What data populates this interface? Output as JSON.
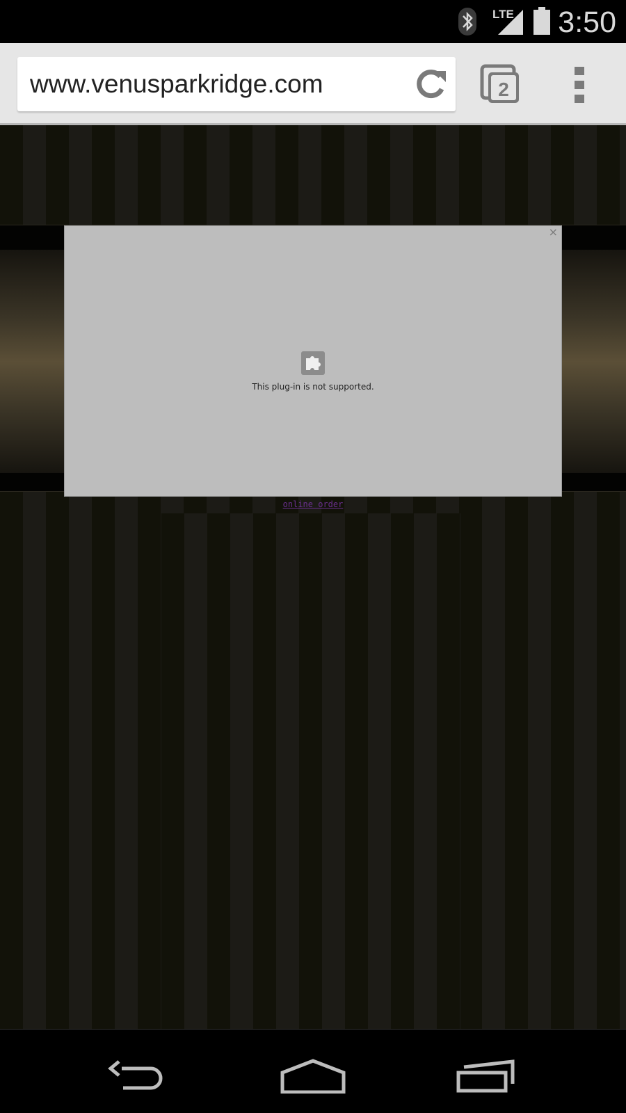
{
  "status_bar": {
    "time": "3:50",
    "network_label": "LTE",
    "icons": [
      "bluetooth-icon",
      "lte-signal-icon",
      "battery-icon"
    ]
  },
  "toolbar": {
    "url": "www.venusparkridge.com",
    "tab_count": "2",
    "icons": [
      "reload-icon",
      "tab-switcher-icon",
      "overflow-menu-icon"
    ]
  },
  "page": {
    "plugin_message": "This plug-in is not supported.",
    "plugin_close": "×",
    "online_order_link": "online order"
  },
  "nav_bar": {
    "icons": [
      "back-icon",
      "home-icon",
      "recent-apps-icon"
    ]
  },
  "colors": {
    "toolbar_bg": "#e6e6e6",
    "plugin_bg": "#bdbdbd",
    "link_color": "#6a2f8e",
    "page_stripe_dark": "#121209",
    "page_stripe_light": "#1c1b16"
  }
}
